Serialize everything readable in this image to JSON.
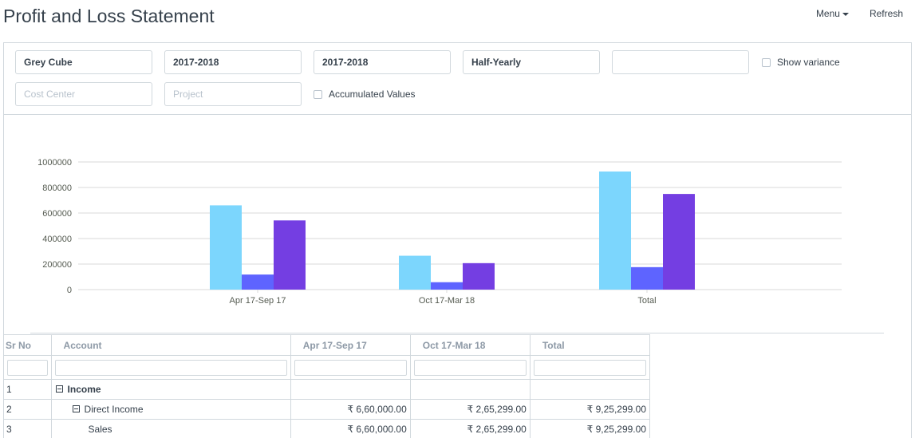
{
  "header": {
    "title": "Profit and Loss Statement",
    "menu_label": "Menu",
    "refresh_label": "Refresh"
  },
  "filters": {
    "company": "Grey Cube",
    "from_fiscal_year": "2017-2018",
    "to_fiscal_year": "2017-2018",
    "periodicity": "Half-Yearly",
    "blank_field": "",
    "cost_center_placeholder": "Cost Center",
    "project_placeholder": "Project",
    "show_variance_label": "Show variance",
    "accumulated_values_label": "Accumulated Values"
  },
  "chart_data": {
    "type": "bar",
    "categories": [
      "Apr 17-Sep 17",
      "Oct 17-Mar 18",
      "Total"
    ],
    "series": [
      {
        "values": [
          660000,
          265299,
          925299
        ],
        "color": "#7cd6fd"
      },
      {
        "values": [
          118000,
          58000,
          176000
        ],
        "color": "#5e64ff"
      },
      {
        "values": [
          542000,
          207299,
          749299
        ],
        "color": "#743ee2"
      }
    ],
    "y_ticks": [
      "0",
      "200000",
      "400000",
      "600000",
      "800000",
      "1000000"
    ],
    "ylim": [
      0,
      1000000
    ],
    "grid": true
  },
  "table": {
    "columns": [
      "Sr No",
      "Account",
      "Apr 17-Sep 17",
      "Oct 17-Mar 18",
      "Total"
    ],
    "rows": [
      {
        "sr": "1",
        "account": "Income",
        "p1": "",
        "p2": "",
        "total": ""
      },
      {
        "sr": "2",
        "account": "Direct Income",
        "p1": "₹ 6,60,000.00",
        "p2": "₹ 2,65,299.00",
        "total": "₹ 9,25,299.00"
      },
      {
        "sr": "3",
        "account": "Sales",
        "p1": "₹ 6,60,000.00",
        "p2": "₹ 2,65,299.00",
        "total": "₹ 9,25,299.00"
      }
    ]
  }
}
